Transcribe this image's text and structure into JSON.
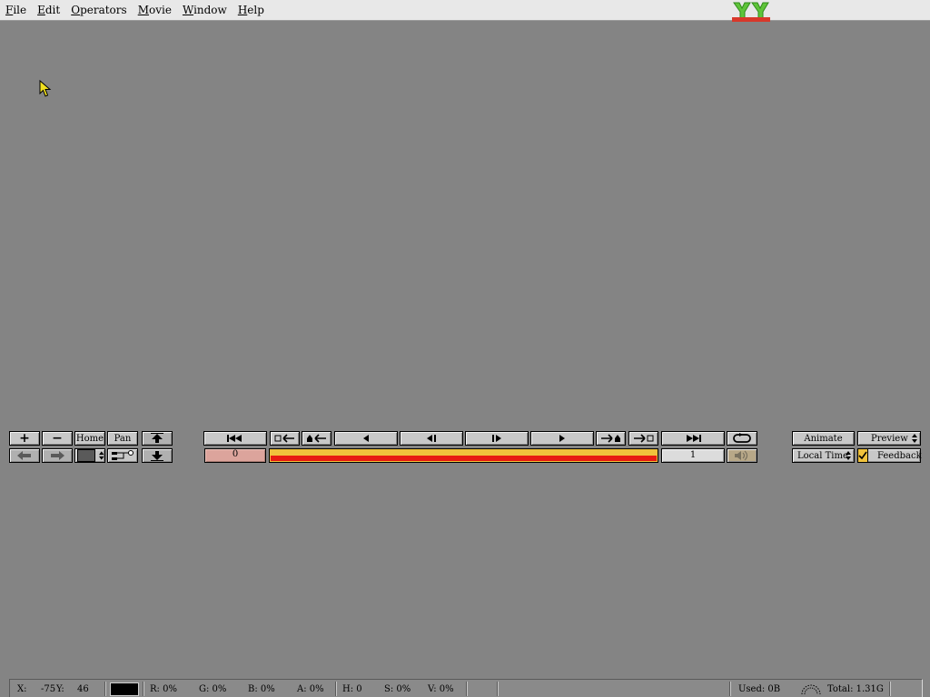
{
  "menu": {
    "items": [
      {
        "label": "File",
        "mnemonic": "F",
        "rest": "ile"
      },
      {
        "label": "Edit",
        "mnemonic": "E",
        "rest": "dit"
      },
      {
        "label": "Operators",
        "mnemonic": "O",
        "rest": "perators"
      },
      {
        "label": "Movie",
        "mnemonic": "M",
        "rest": "ovie"
      },
      {
        "label": "Window",
        "mnemonic": "W",
        "rest": "indow"
      },
      {
        "label": "Help",
        "mnemonic": "H",
        "rest": "elp"
      }
    ]
  },
  "view_controls": {
    "zoom_in": "+",
    "zoom_out": "−",
    "home": "Home",
    "pan": "Pan"
  },
  "transport": {
    "current_time": "0",
    "frame_count": "1"
  },
  "right_panel": {
    "animate": "Animate",
    "preview": "Preview",
    "local_time": "Local Time",
    "feedback": "Feedback",
    "feedback_checked": true
  },
  "status": {
    "x_label": "X:",
    "x_value": "-75",
    "y_label": "Y:",
    "y_value": "46",
    "r": "R: 0%",
    "g": "G: 0%",
    "b": "B: 0%",
    "a": "A: 0%",
    "h": "H: 0",
    "s": "S: 0%",
    "v": "V: 0%",
    "used": "Used: 0B",
    "total": "Total: 1.31G"
  },
  "colors": {
    "background": "#848484",
    "timeline_yellow": "#f0c23c",
    "timeline_red": "#e81b12",
    "time_field": "#dca49c"
  }
}
